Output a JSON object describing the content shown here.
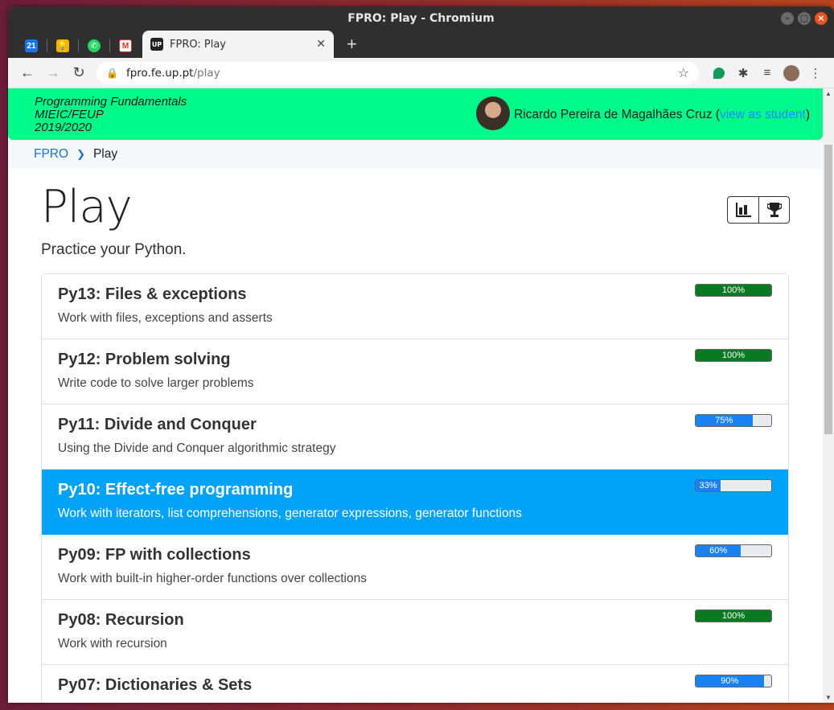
{
  "window": {
    "title": "FPRO: Play - Chromium"
  },
  "tabs": {
    "pinned": [
      {
        "name": "calendar",
        "label": "21",
        "color": "#1a73e8"
      },
      {
        "name": "keep",
        "label": "",
        "color": "#f4b400"
      },
      {
        "name": "whatsapp",
        "label": "",
        "color": "#25d366"
      },
      {
        "name": "gmail",
        "label": "",
        "color": "#d93025"
      }
    ],
    "active": {
      "title": "FPRO: Play",
      "favicon": "UP"
    }
  },
  "address": {
    "host": "fpro.fe.up.pt",
    "path": "/play"
  },
  "header": {
    "course_lines": [
      "Programming Fundamentals",
      "MIEIC/FEUP",
      "2019/2020"
    ],
    "user_name": "Ricardo Pereira de Magalhães Cruz",
    "view_link": "view as student"
  },
  "breadcrumb": {
    "home": "FPRO",
    "current": "Play"
  },
  "page": {
    "title": "Play",
    "subtitle": "Practice your Python."
  },
  "items": [
    {
      "title": "Py13: Files & exceptions",
      "desc": "Work with files, exceptions and asserts",
      "progress": 100,
      "label": "100%",
      "color": "#0a7a22",
      "active": false
    },
    {
      "title": "Py12: Problem solving",
      "desc": "Write code to solve larger problems",
      "progress": 100,
      "label": "100%",
      "color": "#0a7a22",
      "active": false
    },
    {
      "title": "Py11: Divide and Conquer",
      "desc": "Using the Divide and Conquer algorithmic strategy",
      "progress": 75,
      "label": "75%",
      "color": "#1a82f0",
      "active": false
    },
    {
      "title": "Py10: Effect-free programming",
      "desc": "Work with iterators, list comprehensions, generator expressions, generator functions",
      "progress": 33,
      "label": "33%",
      "color": "#1a82f0",
      "active": true
    },
    {
      "title": "Py09: FP with collections",
      "desc": "Work with built-in higher-order functions over collections",
      "progress": 60,
      "label": "60%",
      "color": "#1a82f0",
      "active": false
    },
    {
      "title": "Py08: Recursion",
      "desc": "Work with recursion",
      "progress": 100,
      "label": "100%",
      "color": "#0a7a22",
      "active": false
    },
    {
      "title": "Py07: Dictionaries & Sets",
      "desc": "",
      "progress": 90,
      "label": "90%",
      "color": "#1a82f0",
      "active": false
    }
  ]
}
